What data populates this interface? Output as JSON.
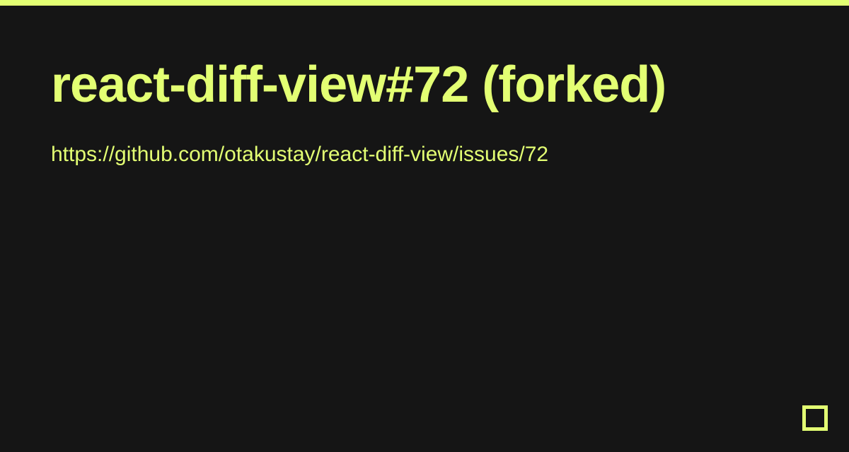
{
  "title": "react-diff-view#72 (forked)",
  "url": "https://github.com/otakustay/react-diff-view/issues/72",
  "colors": {
    "accent": "#e3ff73",
    "background": "#151515"
  }
}
